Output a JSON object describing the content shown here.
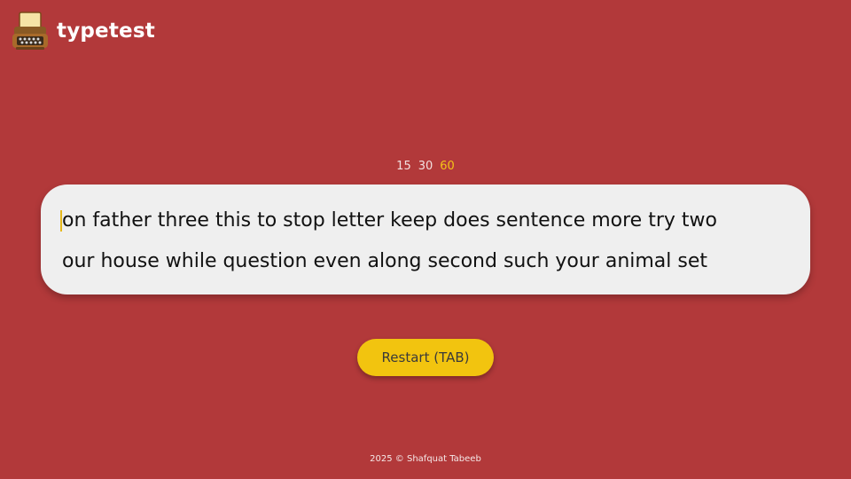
{
  "app": {
    "title": "typetest",
    "logo_icon": "typewriter-icon"
  },
  "durations": {
    "options": [
      "15",
      "30",
      "60"
    ],
    "selected": "60"
  },
  "test": {
    "lines": [
      "on father three this to stop letter keep does sentence more try two",
      "our house while question even along second such your animal set"
    ]
  },
  "restart_button": {
    "label": "Restart (TAB)"
  },
  "footer": {
    "text": "2025 © Shafquat Tabeeb"
  },
  "colors": {
    "background": "#b2393a",
    "accent": "#f2c40f",
    "card": "#efefef"
  }
}
